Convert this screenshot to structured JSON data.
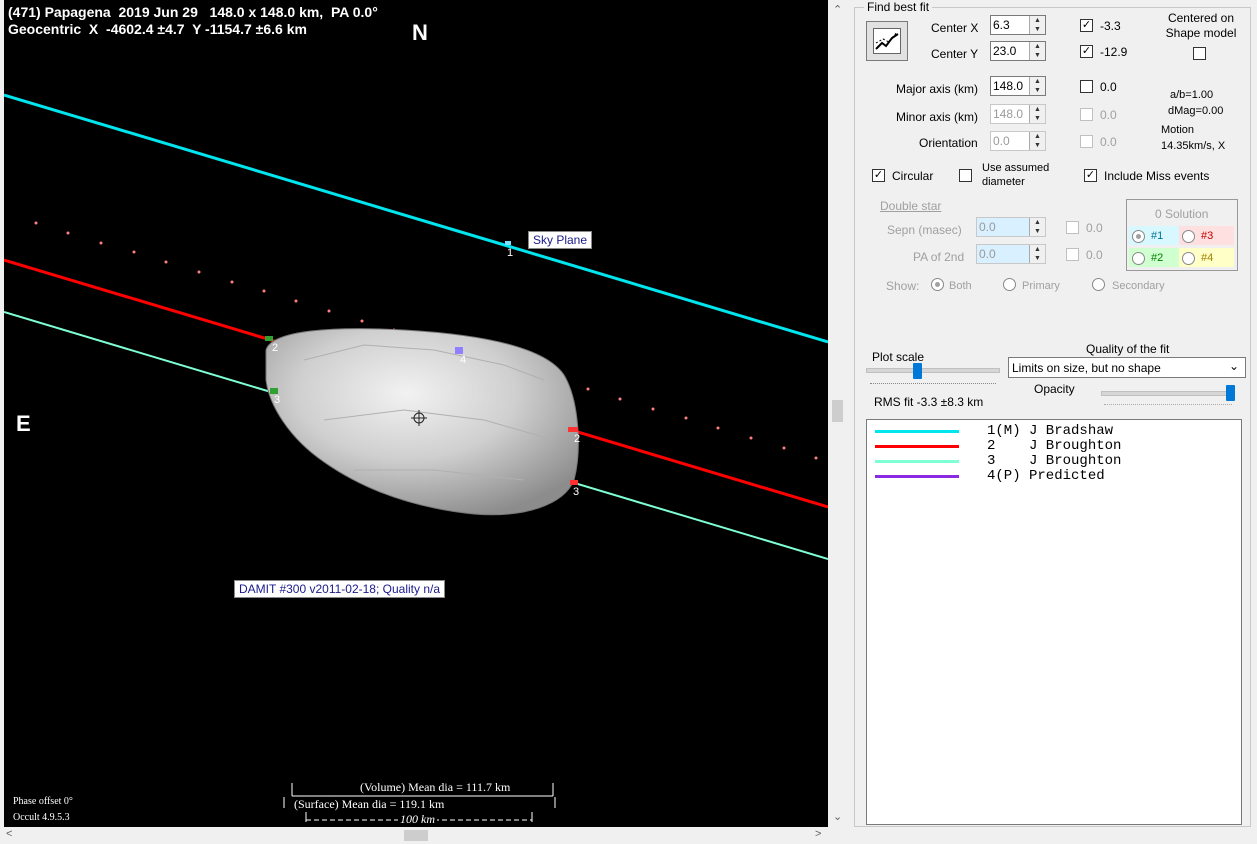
{
  "plot": {
    "title_line1": "(471) Papagena  2019 Jun 29   148.0 x 148.0 km,  PA 0.0°",
    "title_line2": "Geocentric  X  -4602.4 ±4.7  Y -1154.7 ±6.6 km",
    "north": "N",
    "east": "E",
    "sky_plane_label": "Sky Plane",
    "model_label": "DAMIT #300 v2011-02-18; Quality n/a",
    "phase_offset": "Phase offset 0°",
    "version": "Occult 4.9.5.3",
    "volume_dia": "(Volume) Mean dia = 111.7 km",
    "surface_dia": "(Surface) Mean dia = 119.1 km",
    "scale_bar": "100 km",
    "chord_markers": [
      "1",
      "2",
      "3",
      "4",
      "2",
      "3"
    ],
    "colors": {
      "chord1": "#00e5ee",
      "chord2": "#ff0000",
      "chord3": "#7fffd4",
      "predicted": "#ff8080"
    }
  },
  "panel": {
    "find_best_fit": "Find best fit",
    "center_x_label": "Center X",
    "center_x_value": "6.3",
    "center_x_delta": "-3.3",
    "center_y_label": "Center Y",
    "center_y_value": "23.0",
    "center_y_delta": "-12.9",
    "centered_label": "Centered on Shape model",
    "major_label": "Major axis (km)",
    "major_value": "148.0",
    "major_delta": "0.0",
    "minor_label": "Minor axis (km)",
    "minor_value": "148.0",
    "minor_delta": "0.0",
    "orientation_label": "Orientation",
    "orientation_value": "0.0",
    "orientation_delta": "0.0",
    "ab_ratio": "a/b=1.00",
    "dmag": "dMag=0.00",
    "motion_label": "Motion",
    "motion_value": "14.35km/s, X",
    "circular_label": "Circular",
    "assumed_label": "Use assumed diameter",
    "include_miss_label": "Include Miss events",
    "double_star_label": "Double star",
    "sepn_label": "Sepn (masec)",
    "sepn_value": "0.0",
    "sepn_delta": "0.0",
    "pa2_label": "PA of 2nd",
    "pa2_value": "0.0",
    "pa2_delta": "0.0",
    "solution_title": "0 Solution",
    "sol1": "#1",
    "sol2": "#2",
    "sol3": "#3",
    "sol4": "#4",
    "show_label": "Show:",
    "show_both": "Both",
    "show_primary": "Primary",
    "show_secondary": "Secondary",
    "plot_scale_label": "Plot scale",
    "quality_label": "Quality of the fit",
    "quality_value": "Limits on size, but no shape",
    "opacity_label": "Opacity",
    "rms_fit": "RMS fit -3.3 ±8.3 km"
  },
  "legend": [
    {
      "text": "1(M) J Bradshaw",
      "color": "#00e5ee"
    },
    {
      "text": "2    J Broughton",
      "color": "#ff0000"
    },
    {
      "text": "3    J Broughton",
      "color": "#7fffd4"
    },
    {
      "text": "4(P) Predicted",
      "color": "#8a2be2"
    }
  ]
}
